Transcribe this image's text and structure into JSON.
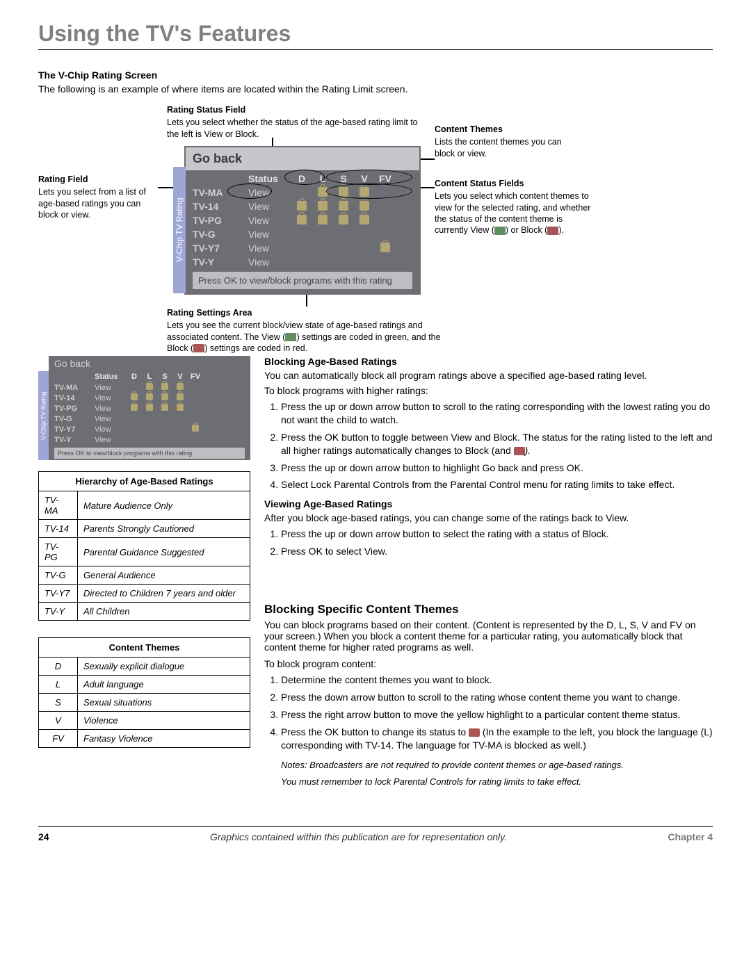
{
  "chapter_title": "Using the TV's Features",
  "vchip": {
    "heading": "The V-Chip Rating Screen",
    "intro": "The following is an example of where items are located within the Rating Limit screen.",
    "labels": {
      "rating_status": {
        "title": "Rating Status Field",
        "body": "Lets you select whether the status of the age-based rating limit to the left is View or Block."
      },
      "content_themes": {
        "title": "Content Themes",
        "body": "Lists the content themes you can block or view."
      },
      "rating_field": {
        "title": "Rating Field",
        "body": "Lets you select from a list of age-based ratings you can block or view."
      },
      "content_status": {
        "title": "Content Status Fields",
        "body": "Lets you select which content themes to view for the selected rating, and whether the status of the content theme is currently View (",
        "body_end": ") or Block (",
        "body_close": ")."
      },
      "settings_area": {
        "title": "Rating Settings Area",
        "body1": "Lets you see the current block/view state of age-based ratings and associated content. The View (",
        "body2": ") settings are coded in green, and the Block (",
        "body3": ") settings are coded in red."
      }
    },
    "osd": {
      "go_back": "Go back",
      "status_hdr": "Status",
      "theme_hdrs": [
        "D",
        "L",
        "S",
        "V",
        "FV"
      ],
      "rows": [
        {
          "rating": "TV-MA",
          "status": "View",
          "themes": [
            false,
            true,
            true,
            true,
            false
          ]
        },
        {
          "rating": "TV-14",
          "status": "View",
          "themes": [
            true,
            true,
            true,
            true,
            false
          ]
        },
        {
          "rating": "TV-PG",
          "status": "View",
          "themes": [
            true,
            true,
            true,
            true,
            false
          ]
        },
        {
          "rating": "TV-G",
          "status": "View",
          "themes": [
            false,
            false,
            false,
            false,
            false
          ]
        },
        {
          "rating": "TV-Y7",
          "status": "View",
          "themes": [
            false,
            false,
            false,
            false,
            true
          ]
        },
        {
          "rating": "TV-Y",
          "status": "View",
          "themes": [
            false,
            false,
            false,
            false,
            false
          ]
        }
      ],
      "hint": "Press OK to view/block programs with this rating",
      "vtab": "V-Chip TV Rating"
    }
  },
  "blocking_age": {
    "heading": "Blocking Age-Based Ratings",
    "intro1": "You can automatically block all program ratings above a specified age-based rating level.",
    "intro2": "To block programs with higher ratings:",
    "steps": [
      "Press the up or down arrow button to scroll to the rating corresponding with the lowest rating you do not want the child to watch.",
      "Press the OK button to toggle between View and Block. The status for the rating listed to the left and all higher ratings automatically changes to Block (and ",
      "Press the up or down arrow button to highlight Go back and press OK.",
      "Select Lock Parental Controls from the Parental Control menu for rating limits to take effect."
    ],
    "step2_end": ")."
  },
  "viewing_age": {
    "heading": "Viewing Age-Based Ratings",
    "intro": "After you block age-based ratings, you can change some of the ratings back to View.",
    "steps": [
      "Press the up or down arrow button to select the rating with a status of Block.",
      "Press OK to select View."
    ]
  },
  "hierarchy_table": {
    "title": "Hierarchy of Age-Based Ratings",
    "rows": [
      [
        "TV-MA",
        "Mature Audience Only"
      ],
      [
        "TV-14",
        "Parents Strongly Cautioned"
      ],
      [
        "TV-PG",
        "Parental Guidance Suggested"
      ],
      [
        "TV-G",
        "General Audience"
      ],
      [
        "TV-Y7",
        "Directed to Children 7 years and older"
      ],
      [
        "TV-Y",
        "All Children"
      ]
    ]
  },
  "themes_table": {
    "title": "Content Themes",
    "rows": [
      [
        "D",
        "Sexually explicit dialogue"
      ],
      [
        "L",
        "Adult language"
      ],
      [
        "S",
        "Sexual situations"
      ],
      [
        "V",
        "Violence"
      ],
      [
        "FV",
        "Fantasy Violence"
      ]
    ]
  },
  "blocking_content": {
    "heading": "Blocking Specific Content Themes",
    "intro1": "You can block programs based on their content. (Content is represented by the D, L, S, V and FV on your screen.) When you block a content theme for a particular rating, you automatically block that content theme for higher rated programs as well.",
    "intro2": "To block program content:",
    "steps": [
      "Determine the content themes you want to block.",
      "Press the down arrow button to scroll to the rating whose content theme you want to change.",
      "Press the right arrow button to move the yellow highlight to a particular content theme status.",
      "Press the OK button to change its status to "
    ],
    "step4_end": " (In the example to the left, you block the language (L) corresponding with TV-14. The language for TV-MA is blocked as well.)",
    "note1": "Notes: Broadcasters are not required to provide content themes or age-based ratings.",
    "note2": "You must remember to lock Parental Controls for rating limits to take effect."
  },
  "footer": {
    "page": "24",
    "mid": "Graphics contained within this publication are for representation only.",
    "chapter": "Chapter 4"
  }
}
